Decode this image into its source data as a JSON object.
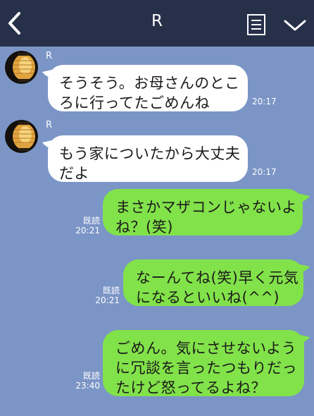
{
  "header": {
    "title": "R",
    "background": "#263049",
    "back_icon": "chevron-left-icon",
    "notes_icon": "notes-icon",
    "menu_icon": "chevron-down-icon"
  },
  "chat": {
    "background": "#7b95c6",
    "incoming_color": "#ffffff",
    "outgoing_color": "#82e24a",
    "messages": [
      {
        "direction": "incoming",
        "sender": "R",
        "lines": [
          "そうそう。お母さんのとこ",
          "ろに行ってたごめんね"
        ],
        "time": "20:17"
      },
      {
        "direction": "incoming",
        "sender": "R",
        "lines": [
          "もう家についたから大丈夫",
          "だよ"
        ],
        "time": "20:17"
      },
      {
        "direction": "outgoing",
        "read_label": "既読",
        "lines": [
          "まさかマザコンじゃないよ",
          "ね？(笑)"
        ],
        "time": "20:21"
      },
      {
        "direction": "outgoing",
        "read_label": "既読",
        "lines": [
          "なーんてね(笑)早く元気",
          "になるといいね(^^)"
        ],
        "time": "20:21"
      },
      {
        "direction": "outgoing",
        "read_label": "既読",
        "lines": [
          "ごめん。気にさせないよう",
          "に冗談を言ったつもりだっ",
          "たけど怒ってるよね？"
        ],
        "time": "23:40"
      }
    ]
  }
}
